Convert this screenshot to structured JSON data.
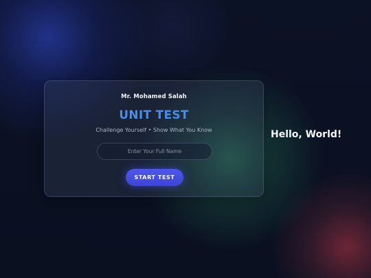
{
  "card": {
    "author": "Mr. Mohamed Salah",
    "title": "UNIT TEST",
    "subtitle": "Challenge Yourself • Show What You Know",
    "name_input": {
      "value": "",
      "placeholder": "Enter Your Full Name"
    },
    "start_label": "START TEST"
  },
  "side_text": "Hello, World!",
  "colors": {
    "title": "#4a8de8",
    "button": "#4650e0",
    "background": "#0b1122"
  }
}
